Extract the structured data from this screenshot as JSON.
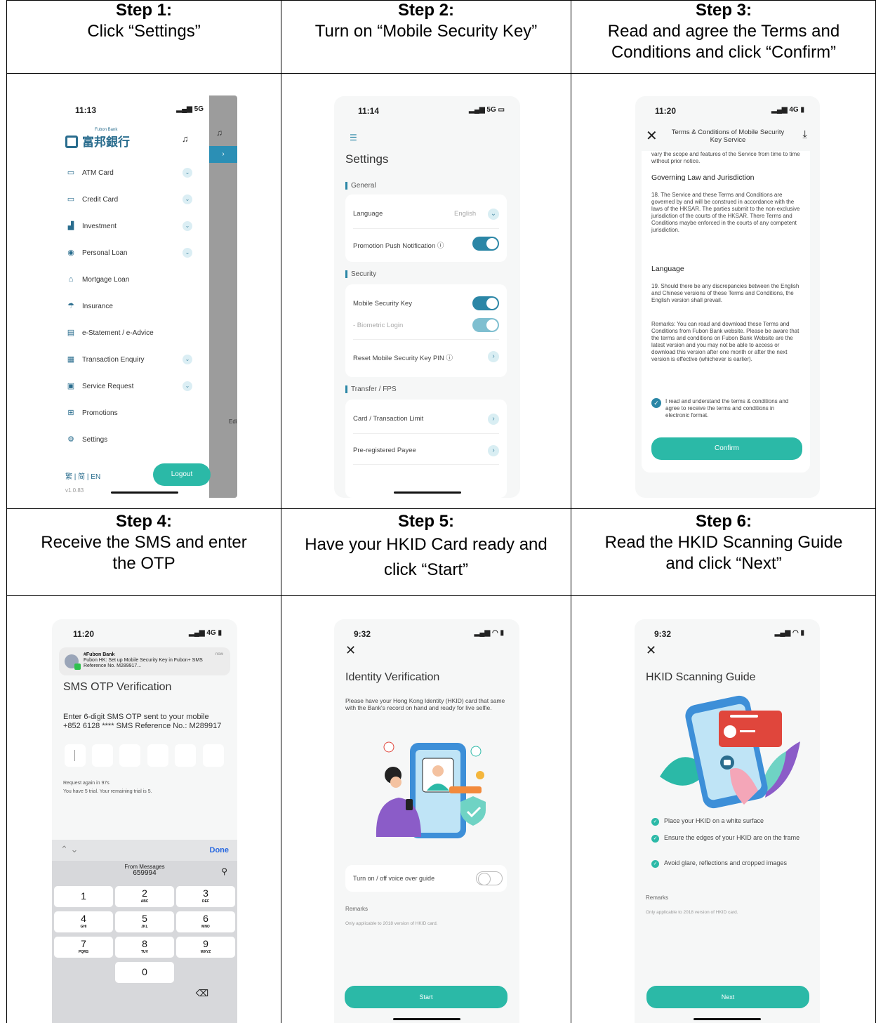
{
  "steps": [
    {
      "no": "Step 1:",
      "desc": "Click “Settings”"
    },
    {
      "no": "Step 2:",
      "desc": "Turn on “Mobile Security Key”"
    },
    {
      "no": "Step 3:",
      "desc": "Read and agree the Terms and Conditions and click “Confirm”"
    },
    {
      "no": "Step 4:",
      "desc": "Receive the SMS and enter the OTP"
    },
    {
      "no": "Step 5:",
      "desc": "Have your HKID Card ready and click “Start”"
    },
    {
      "no": "Step 6:",
      "desc": "Read the HKID Scanning Guide and click “Next”"
    }
  ],
  "phone1": {
    "time": "11:13",
    "signal": "5G",
    "logo_en": "Fubon Bank",
    "logo_zh": "富邦銀行",
    "menu": [
      {
        "label": "ATM Card",
        "icon": "card-icon",
        "glyph": "▭",
        "chev": true
      },
      {
        "label": "Credit Card",
        "icon": "credit-card-icon",
        "glyph": "▭",
        "chev": true
      },
      {
        "label": "Investment",
        "icon": "investment-icon",
        "glyph": "▟",
        "chev": true
      },
      {
        "label": "Personal Loan",
        "icon": "personal-loan-icon",
        "glyph": "◉",
        "chev": true
      },
      {
        "label": "Mortgage Loan",
        "icon": "mortgage-icon",
        "glyph": "⌂",
        "chev": false
      },
      {
        "label": "Insurance",
        "icon": "umbrella-icon",
        "glyph": "☂",
        "chev": false
      },
      {
        "label": "e-Statement / e-Advice",
        "icon": "statement-icon",
        "glyph": "▤",
        "chev": false
      },
      {
        "label": "Transaction Enquiry",
        "icon": "enquiry-icon",
        "glyph": "▦",
        "chev": true
      },
      {
        "label": "Service Request",
        "icon": "service-icon",
        "glyph": "▣",
        "chev": true
      },
      {
        "label": "Promotions",
        "icon": "gift-icon",
        "glyph": "⊞",
        "chev": false
      },
      {
        "label": "Settings",
        "icon": "gear-icon",
        "glyph": "⚙",
        "chev": false
      }
    ],
    "langs": "繁 | 简 | EN",
    "logout": "Logout",
    "version": "v1.0.83",
    "edit": "Edit"
  },
  "phone2": {
    "time": "11:14",
    "signal": "5G",
    "title": "Settings",
    "sections": {
      "general": "General",
      "security": "Security",
      "transfer": "Transfer / FPS"
    },
    "language": "Language",
    "language_value": "English",
    "promo_push": "Promotion Push Notification ⓘ",
    "mobile_key": "Mobile Security Key",
    "biometric": "- Biometric Login",
    "reset_pin": "Reset Mobile Security Key PIN ⓘ",
    "card_limit": "Card / Transaction Limit",
    "payee": "Pre-registered Payee"
  },
  "phone3": {
    "time": "11:20",
    "signal": "4G",
    "header": "Terms & Conditions of Mobile Security Key Service",
    "intro": "vary the scope and features of the Service from time to time without prior notice.",
    "h1": "Governing Law and Jurisdiction",
    "p18": "18. The Service and these Terms and Conditions are governed by and will be construed in accordance with the laws of the HKSAR. The parties submit to the non-exclusive jurisdiction of the courts of the HKSAR. There Terms and Conditions maybe enforced in the courts of any competent jurisdiction.",
    "h2": "Language",
    "p19": "19. Should there be any discrepancies between the English and Chinese versions of these Terms and Conditions, the English version shall prevail.",
    "remarks": "Remarks: You can read and download these Terms and Conditions from Fubon Bank website. Please be aware that the terms and conditions on Fubon Bank Website are the latest version and you may not be able to access or download this version after one month or after the next version is effective (whichever is earlier).",
    "agree": "I read and understand the terms & conditions and agree to receive the terms and conditions in electronic format.",
    "confirm": "Confirm"
  },
  "phone4": {
    "time": "11:20",
    "signal": "4G",
    "notif_title": "#Fubon Bank",
    "notif_body": "Fubon HK: Set up Mobile Security Key in Fubon+ SMS Reference No. M289917...",
    "notif_time": "now",
    "title": "SMS OTP Verification",
    "desc": "Enter 6-digit SMS OTP sent to your mobile +852 6128 **** SMS Reference No.: M289917",
    "request_again": "Request again in 97s",
    "trials": "You have 5 trial. Your remaining trial is 5.",
    "done": "Done",
    "from_messages": "From Messages",
    "suggested_code": "659994",
    "keys": [
      {
        "n": "1",
        "l": ""
      },
      {
        "n": "2",
        "l": "ABC"
      },
      {
        "n": "3",
        "l": "DEF"
      },
      {
        "n": "4",
        "l": "GHI"
      },
      {
        "n": "5",
        "l": "JKL"
      },
      {
        "n": "6",
        "l": "MNO"
      },
      {
        "n": "7",
        "l": "PQRS"
      },
      {
        "n": "8",
        "l": "TUV"
      },
      {
        "n": "9",
        "l": "WXYZ"
      },
      {
        "n": "0",
        "l": ""
      }
    ]
  },
  "phone5": {
    "time": "9:32",
    "title": "Identity Verification",
    "desc": "Please have your Hong Kong Identity (HKID) card that same with the Bank's record on hand and ready for live selfie.",
    "voice": "Turn on / off voice over guide",
    "remarks": "Remarks",
    "remarks_text": "Only applicable to 2018 version of HKID card.",
    "start": "Start"
  },
  "phone6": {
    "time": "9:32",
    "title": "HKID Scanning Guide",
    "bullets": [
      "Place your HKID on a white surface",
      "Ensure the edges of your HKID are on the frame",
      "Avoid glare, reflections and cropped images"
    ],
    "remarks": "Remarks",
    "remarks_text": "Only applicable to 2018 version of HKID card.",
    "next": "Next"
  },
  "colors": {
    "teal": "#2bb9a7",
    "brand_blue": "#2a6d8e",
    "toggle_blue": "#2b86a6"
  }
}
